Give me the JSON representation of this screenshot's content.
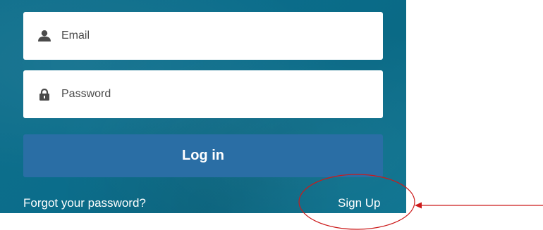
{
  "login_form": {
    "email_placeholder": "Email",
    "password_placeholder": "Password",
    "login_label": "Log in",
    "forgot_label": "Forgot your password?",
    "signup_label": "Sign Up"
  },
  "icons": {
    "email": "user-icon",
    "password": "lock-icon"
  },
  "colors": {
    "panel_background": "#0b6d8b",
    "login_button": "#2a6ea5",
    "annotation": "#cc1a1a"
  }
}
